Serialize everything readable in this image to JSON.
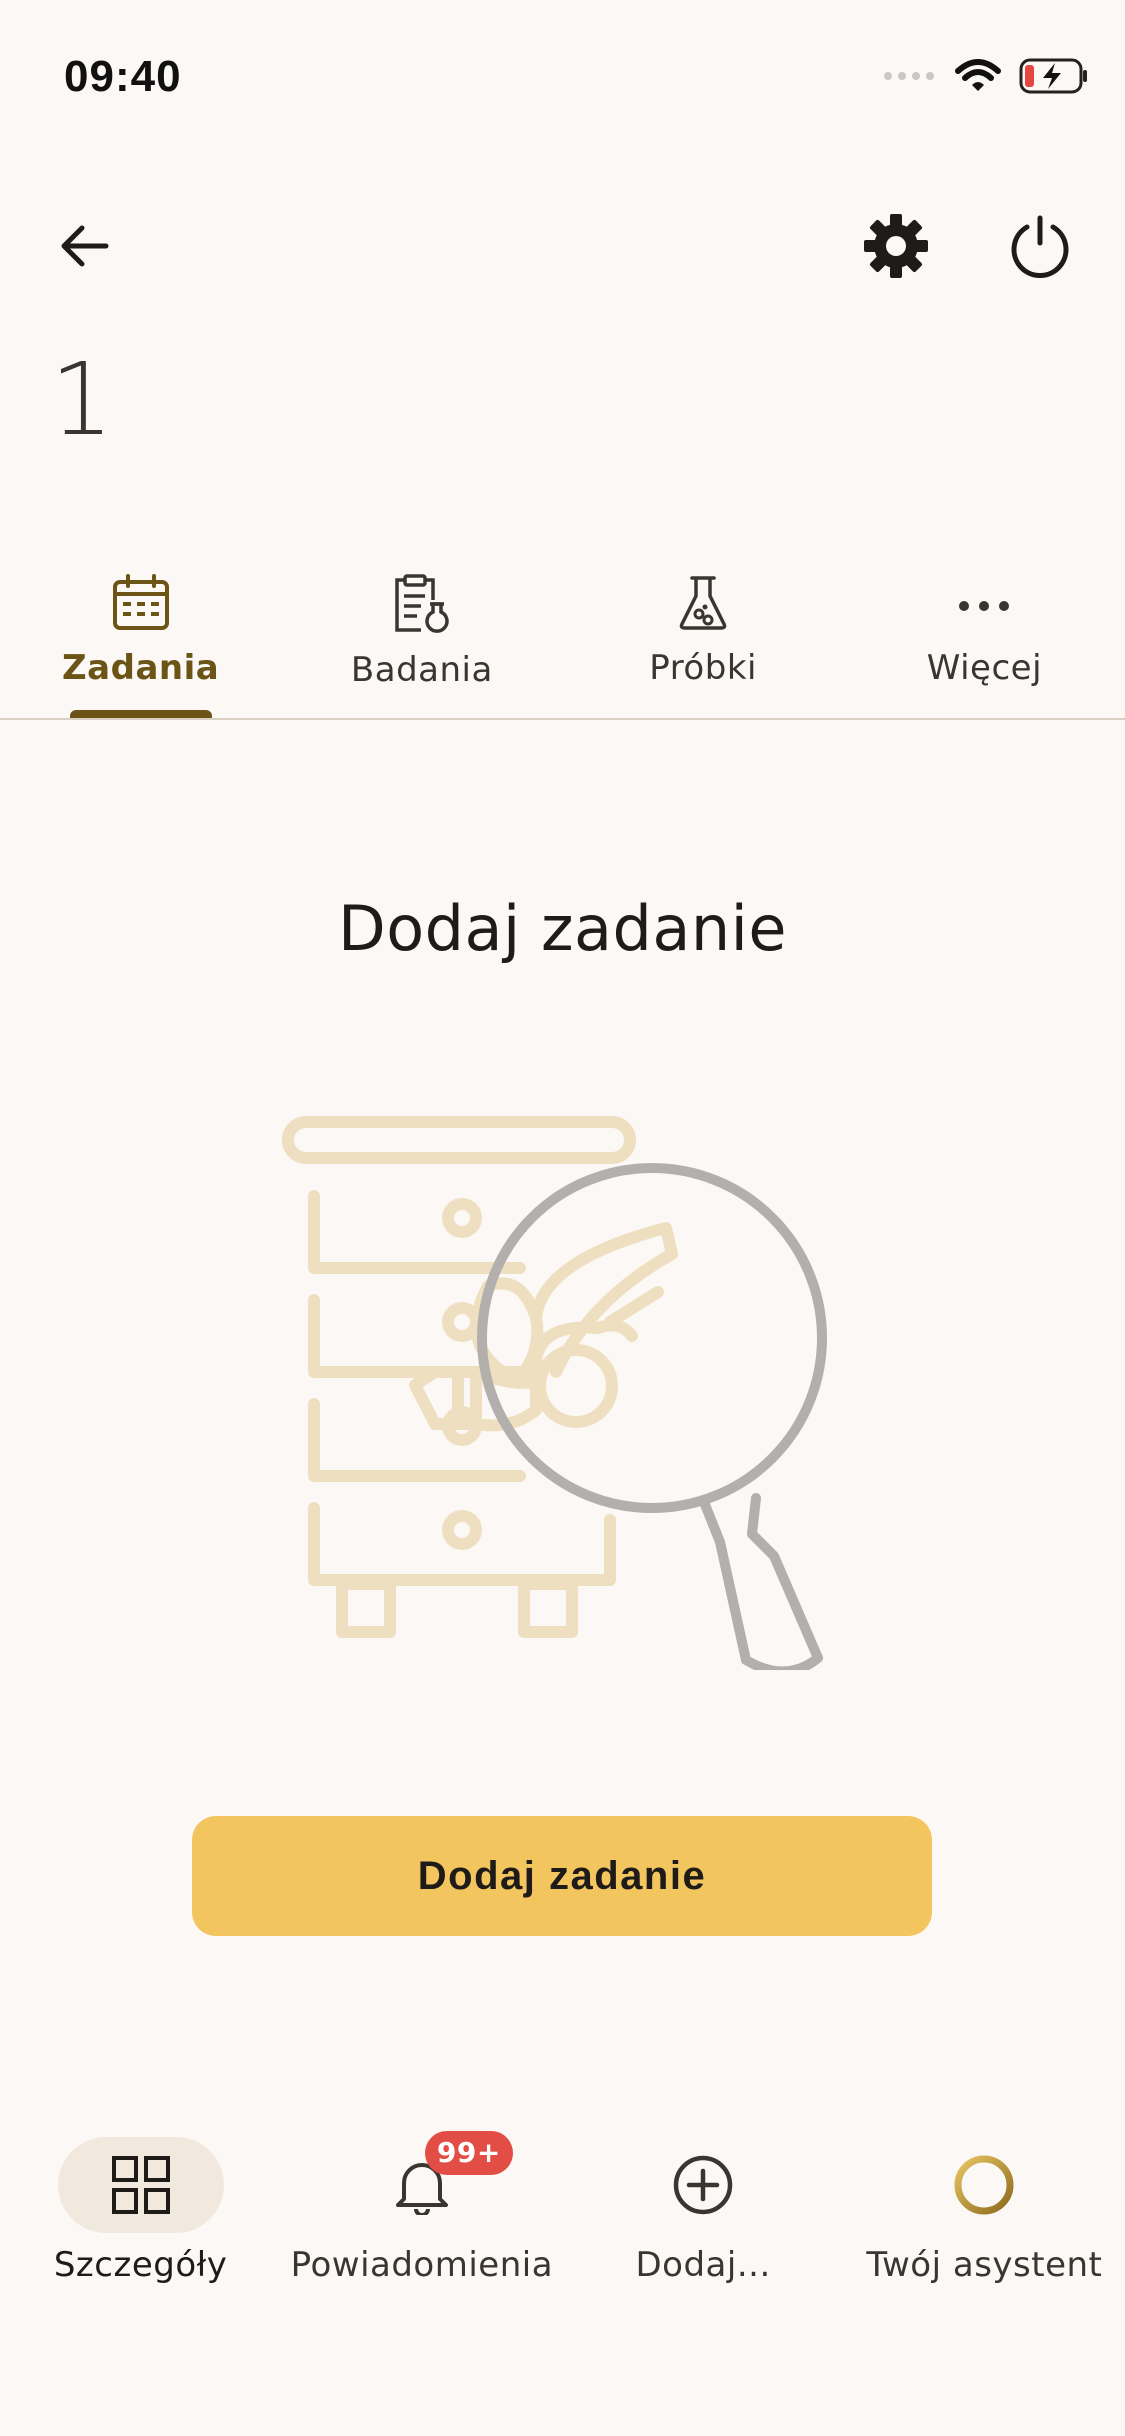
{
  "status_bar": {
    "time": "09:40"
  },
  "header": {
    "hive_number": "1"
  },
  "tabs": [
    {
      "label": "Zadania",
      "icon": "calendar-icon",
      "active": true
    },
    {
      "label": "Badania",
      "icon": "clipboard-flask-icon",
      "active": false
    },
    {
      "label": "Próbki",
      "icon": "flask-icon",
      "active": false
    },
    {
      "label": "Więcej",
      "icon": "more-horizontal-icon",
      "active": false
    }
  ],
  "main": {
    "empty_title": "Dodaj zadanie",
    "illustration": "beehive-magnifier-bee-illustration",
    "add_button_label": "Dodaj zadanie"
  },
  "bottom_nav": [
    {
      "label": "Szczegóły",
      "icon": "grid-icon",
      "active": true
    },
    {
      "label": "Powiadomienia",
      "icon": "bell-icon",
      "badge": "99+"
    },
    {
      "label": "Dodaj...",
      "icon": "plus-circle-icon"
    },
    {
      "label": "Twój asystent",
      "icon": "assistant-ring-icon"
    }
  ],
  "colors": {
    "background": "#FCF8F5",
    "accent": "#6B5416",
    "primary_button": "#F3C55F",
    "badge": "#E24E46",
    "illustration_hive": "#EEDFC0",
    "illustration_glass": "#B3AFAC"
  }
}
